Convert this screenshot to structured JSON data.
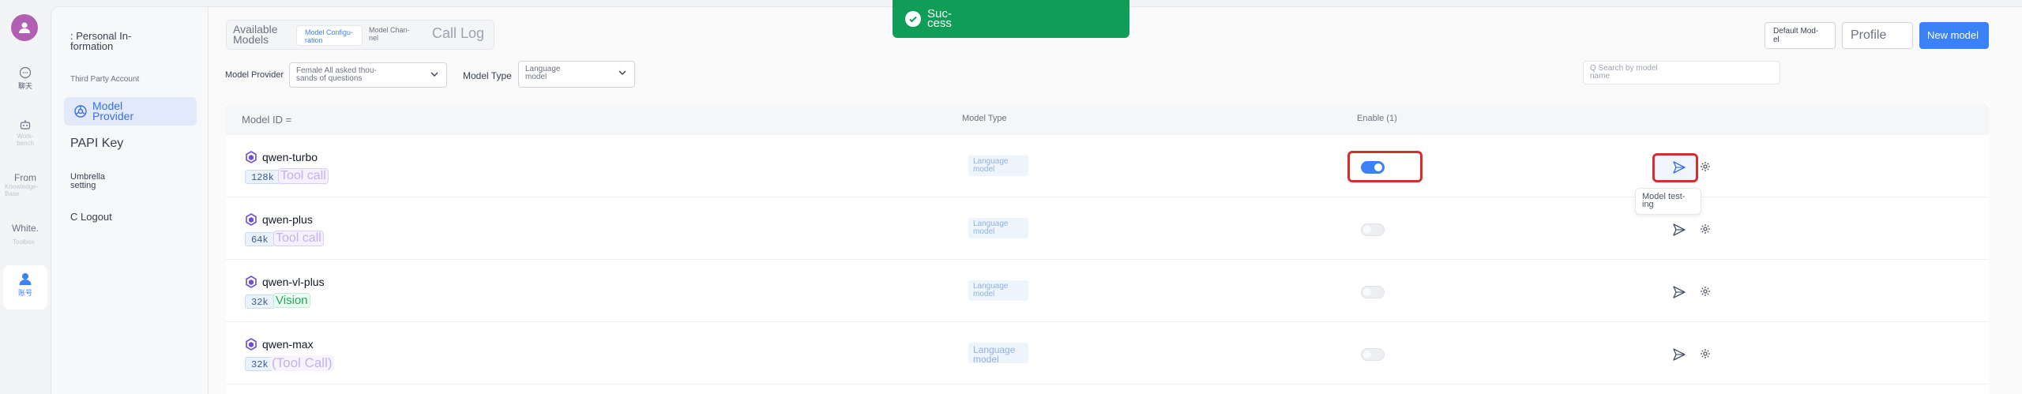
{
  "rail": {
    "items": [
      {
        "label": "聊天"
      },
      {
        "label": "Work-\nbench"
      },
      {
        "label": "From",
        "sub": "Knowledge-\nBase"
      },
      {
        "label": "White.",
        "sub": "Toolbox"
      },
      {
        "label": "账号"
      }
    ]
  },
  "settings": {
    "personal_info": ": Personal In-\nformation",
    "third_party": "Third Party Account",
    "model_provider": "Model\nProvider",
    "papi_key": "PAPI Key",
    "umbrella": "Umbrella\nsetting",
    "logout": "C Logout"
  },
  "tabs": {
    "available": "Available\nModels",
    "model_config": "Model Configu-\nration",
    "model_channel": "Model Chan-\nnel",
    "call_log": "Call Log"
  },
  "filters": {
    "provider_label": "Model Provider",
    "provider_value": "Female All asked thou-\nsands of questions",
    "type_label": "Model Type",
    "type_value": "Language\nmodel",
    "search_placeholder": "Q Search by model\nname"
  },
  "actions": {
    "default_model": "Default Mod-\nel",
    "profile": "Profile",
    "new_model": "New model"
  },
  "table": {
    "headers": {
      "model_id": "Model ID =",
      "model_type": "Model Type",
      "enable": "Enable (1)"
    },
    "rows": [
      {
        "name": "qwen-turbo",
        "context": "128k",
        "capability": "Tool call",
        "cap_kind": "tool",
        "type": "Language\nmodel",
        "enabled": true
      },
      {
        "name": "qwen-plus",
        "context": "64k",
        "capability": "Tool call",
        "cap_kind": "tool",
        "type": "Language\nmodel",
        "enabled": false
      },
      {
        "name": "qwen-vl-plus",
        "context": "32k",
        "capability": "Vision",
        "cap_kind": "vision",
        "type": "Language\nmodel",
        "enabled": false
      },
      {
        "name": "qwen-max",
        "context": "32k",
        "capability": "(Tool Call)",
        "cap_kind": "tool",
        "type": "Language\nmodel",
        "enabled": false
      }
    ]
  },
  "tooltip": "Model test-\ning",
  "toast": "Suc-\ncess",
  "colors": {
    "accent": "#3b82f6",
    "success": "#0f9d58",
    "highlight": "#d32f2f",
    "avatar": "#b15fb1"
  }
}
